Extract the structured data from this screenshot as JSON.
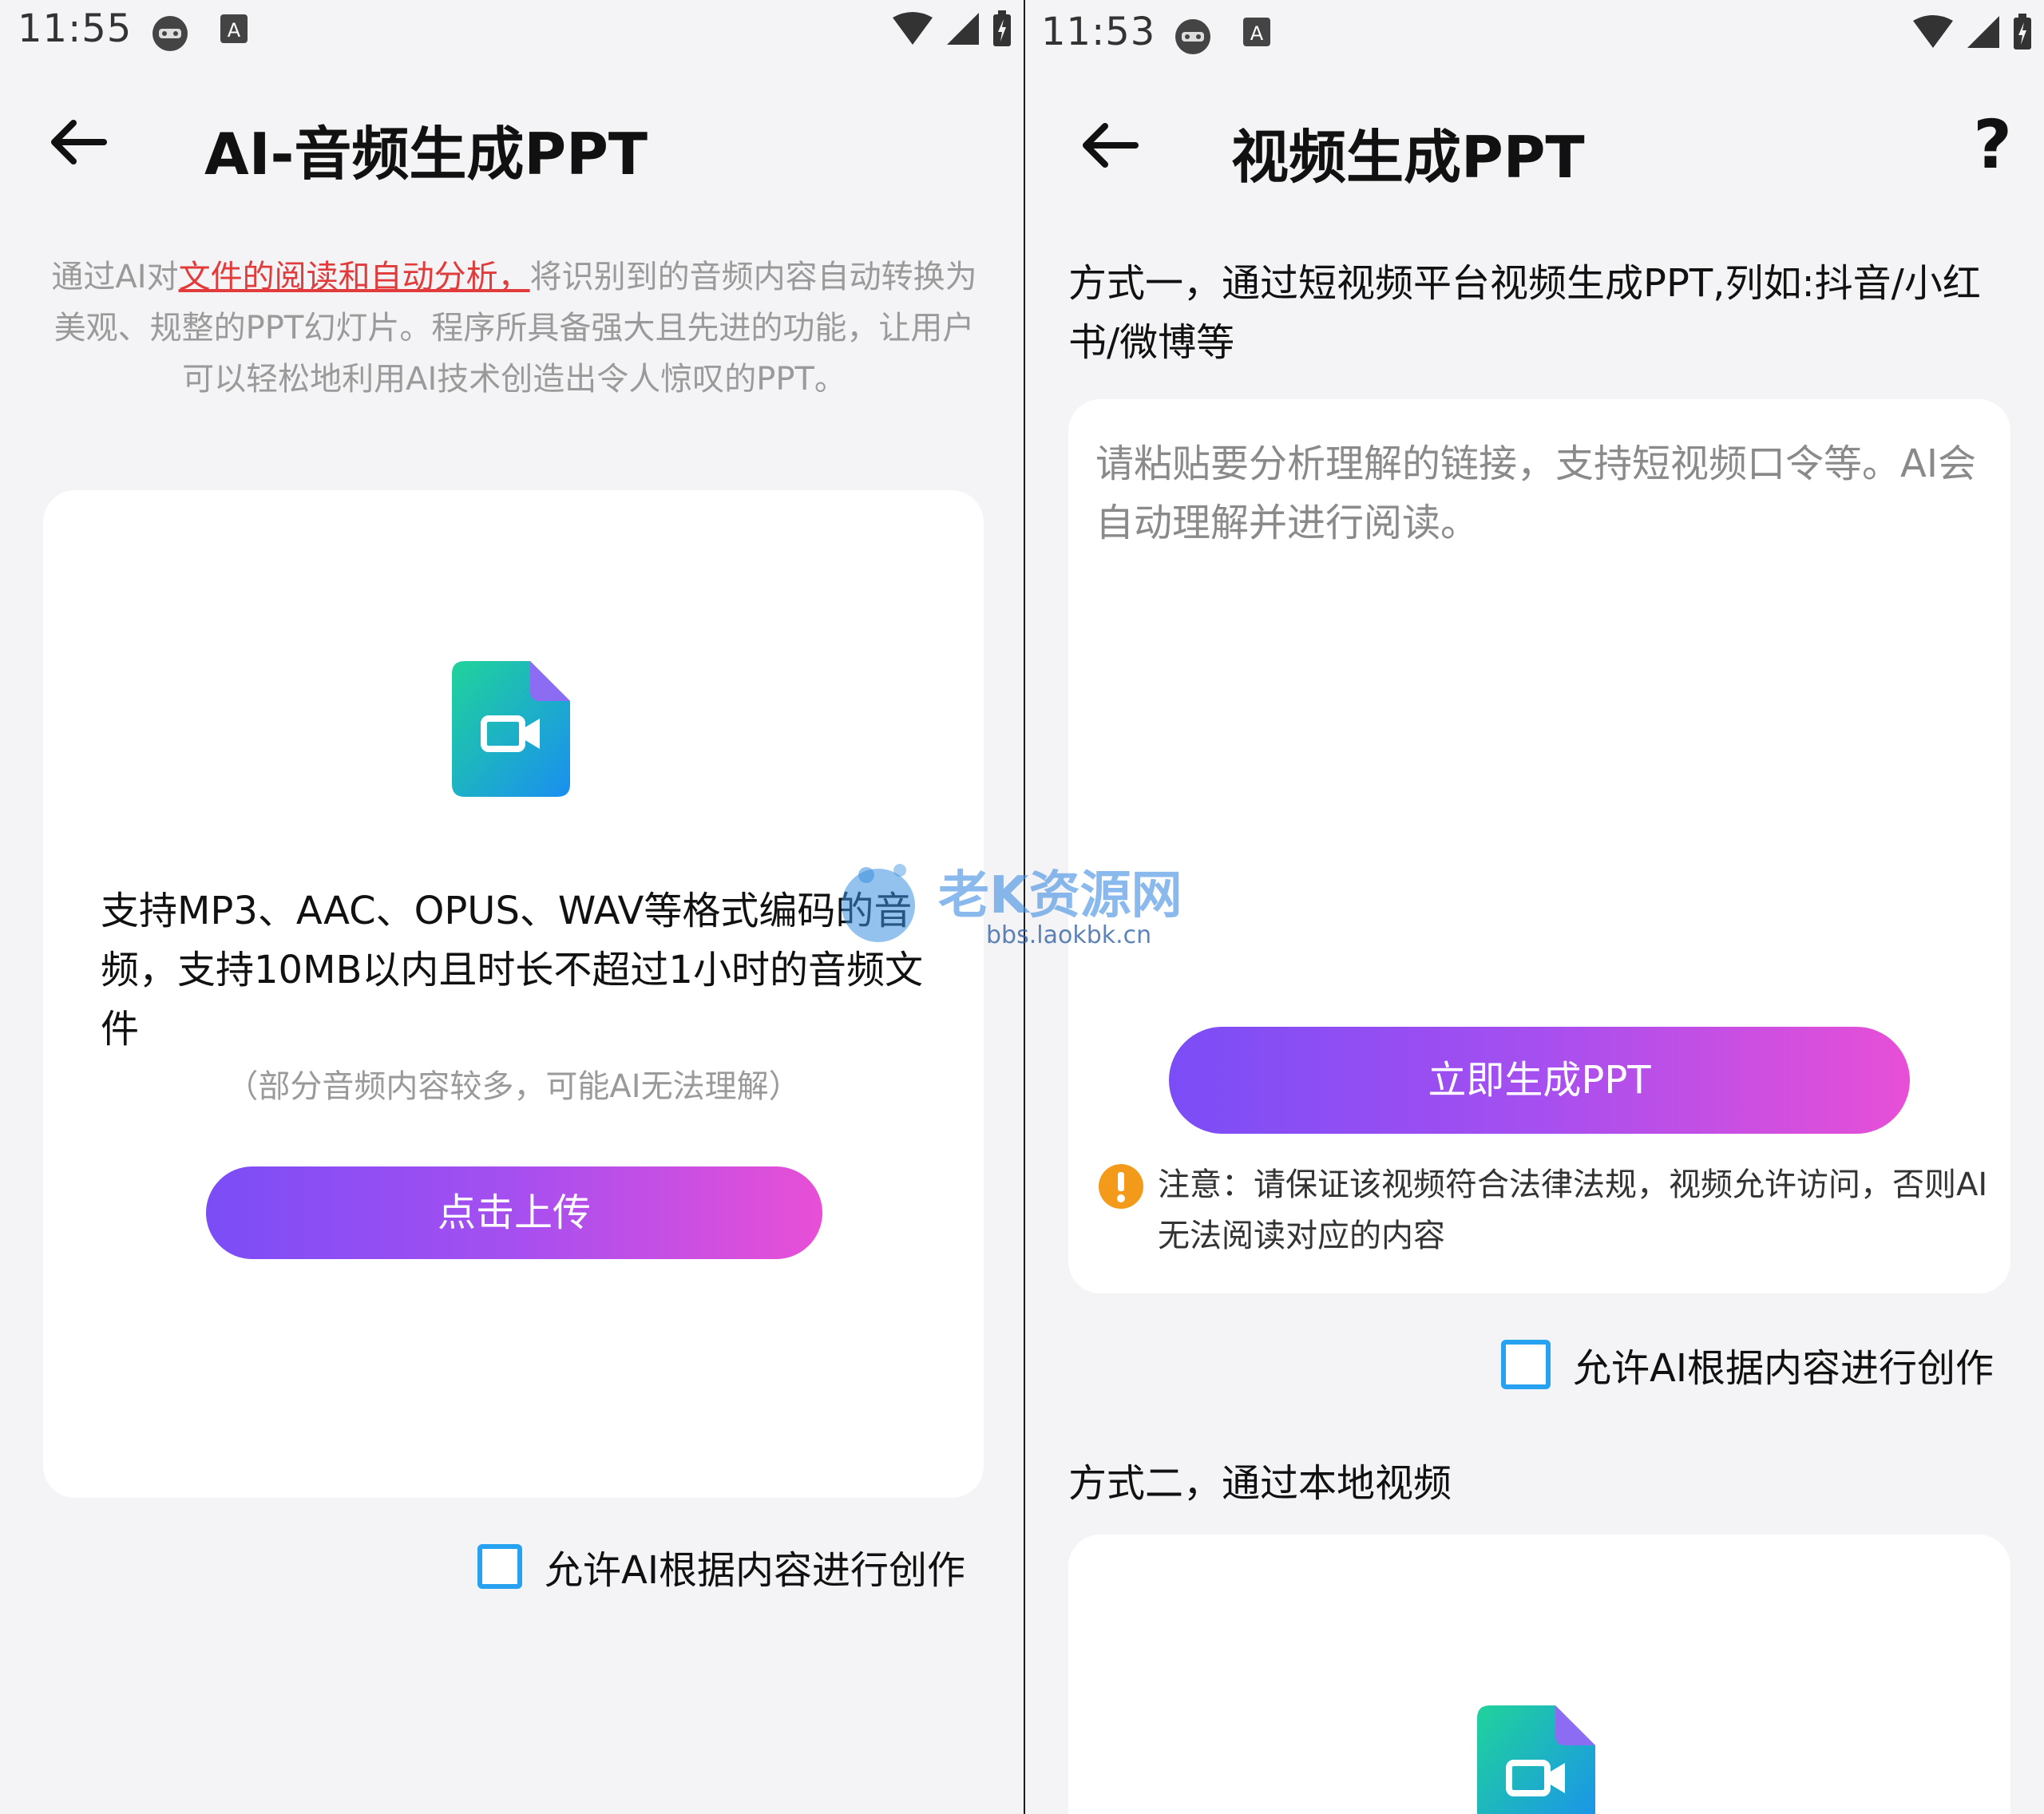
{
  "left": {
    "status": {
      "time": "11:55"
    },
    "title": "AI-音频生成PPT",
    "description": {
      "before": "通过AI对",
      "highlight": "文件的阅读和自动分析，",
      "after": "将识别到的音频内容自动转换为美观、规整的PPT幻灯片。程序所具备强大且先进的功能，让用户可以轻松地利用AI技术创造出令人惊叹的PPT。"
    },
    "upload_card": {
      "support_text": "支持MP3、AAC、OPUS、WAV等格式编码的音频，支持10MB以内且时长不超过1小时的音频文件",
      "note": "（部分音频内容较多，可能AI无法理解）",
      "button_label": "点击上传"
    },
    "checkbox_label": "允许AI根据内容进行创作"
  },
  "right": {
    "status": {
      "time": "11:53"
    },
    "title": "视频生成PPT",
    "help_label": "?",
    "method1_heading": "方式一，通过短视频平台视频生成PPT,列如:抖音/小红书/微博等",
    "link_input_placeholder": "请粘贴要分析理解的链接，支持短视频口令等。AI会自动理解并进行阅读。",
    "generate_button_label": "立即生成PPT",
    "notice_label": "注意：",
    "notice_text": "请保证该视频符合法律法规，视频允许访问，否则AI无法阅读对应的内容",
    "checkbox_label": "允许AI根据内容进行创作",
    "method2_heading": "方式二，通过本地视频"
  },
  "watermark": {
    "brand": "老K资源网",
    "url": "bbs.laokbk.cn"
  },
  "colors": {
    "accent_gradient_start": "#7b4df6",
    "accent_gradient_end": "#e84fd6",
    "checkbox_blue": "#26a2f0",
    "highlight_red": "#e23b3b",
    "warning_orange": "#f39a1b"
  }
}
